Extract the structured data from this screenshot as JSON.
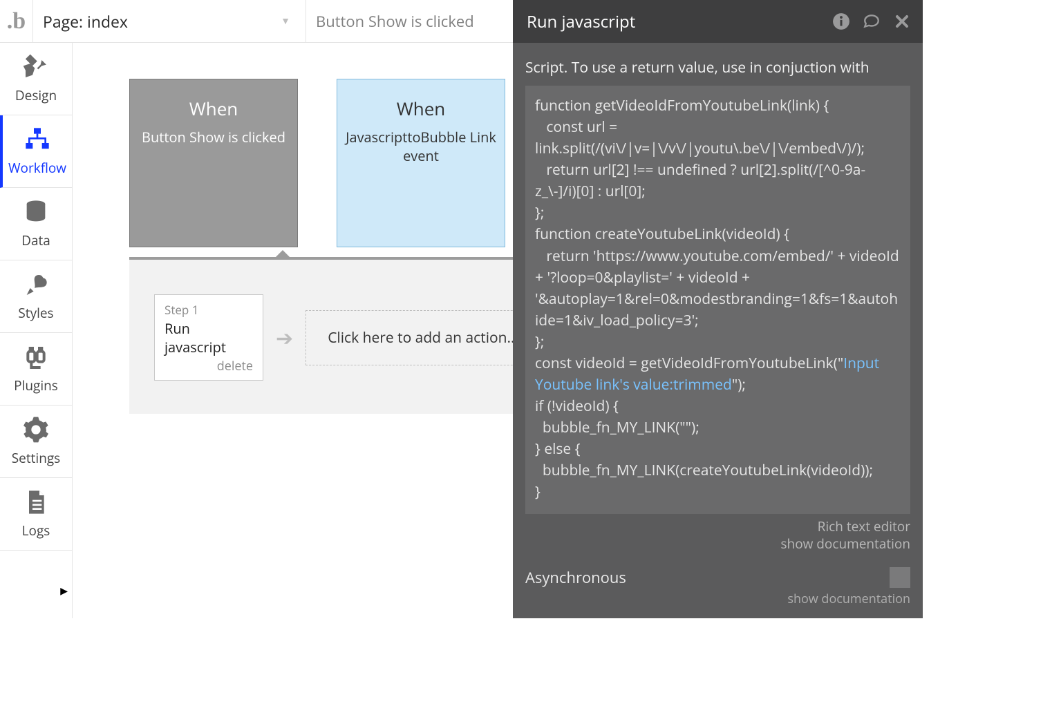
{
  "logo_text": ".b",
  "page_selector": {
    "label": "Page: index"
  },
  "current_event_label": "Button Show is clicked",
  "panel_title": "Run javascript",
  "sidebar": {
    "items": [
      {
        "label": "Design"
      },
      {
        "label": "Workflow"
      },
      {
        "label": "Data"
      },
      {
        "label": "Styles"
      },
      {
        "label": "Plugins"
      },
      {
        "label": "Settings"
      },
      {
        "label": "Logs"
      }
    ]
  },
  "events": [
    {
      "when": "When",
      "desc": "Button Show is clicked",
      "selected": true
    },
    {
      "when": "When",
      "desc": "JavascripttoBubble Link event",
      "selected": false
    }
  ],
  "step": {
    "line1": "Step 1",
    "line2": "Run javascript",
    "delete": "delete"
  },
  "add_action_label": "Click here to add an action...",
  "script_label": "Script. To use a return value, use in conjuction with",
  "code": {
    "pre": "function getVideoIdFromYoutubeLink(link) {\n   const url = link.split(/(vi\\/|v=|\\/v\\/|youtu\\.be\\/|\\/embed\\/)/);\n   return url[2] !== undefined ? url[2].split(/[^0-9a-z_\\-]/i)[0] : url[0];\n};\nfunction createYoutubeLink(videoId) {\n   return 'https://www.youtube.com/embed/' + videoId + '?loop=0&playlist=' + videoId + '&autoplay=1&rel=0&modestbranding=1&fs=1&autohide=1&iv_load_policy=3';\n};\nconst videoId = getVideoIdFromYoutubeLink(\"",
    "dyn": "Input Youtube link's value:trimmed",
    "post": "\");\nif (!videoId) {\n  bubble_fn_MY_LINK(\"\");\n} else {\n  bubble_fn_MY_LINK(createYoutubeLink(videoId));\n}"
  },
  "rich_text_link": "Rich text editor",
  "show_doc_link": "show documentation",
  "async_label": "Asynchronous",
  "async_doc_link": "show documentation"
}
